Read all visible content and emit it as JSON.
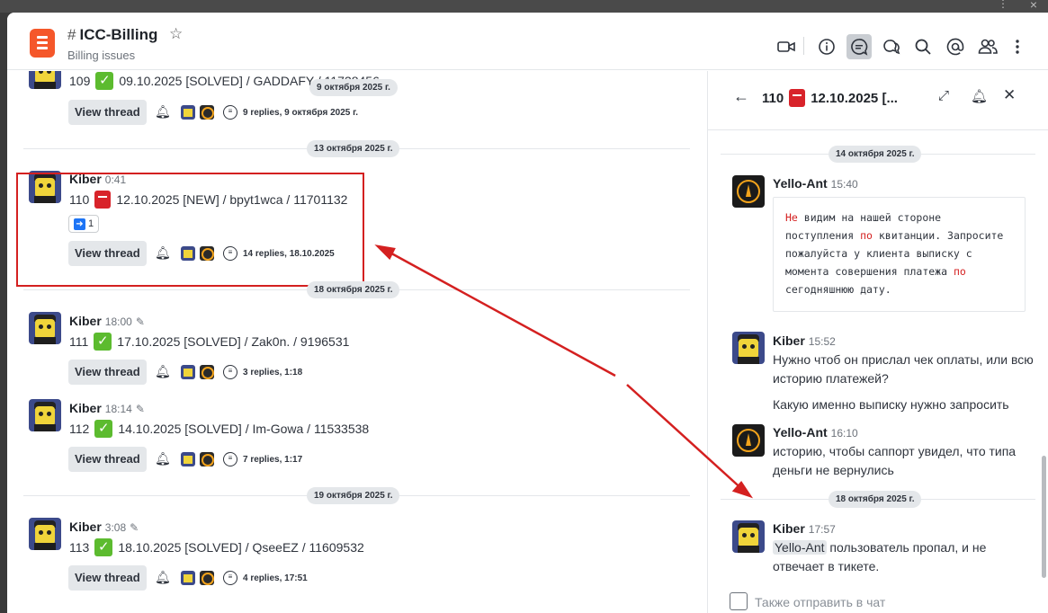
{
  "channel": {
    "name": "ICC-Billing",
    "topic": "Billing issues"
  },
  "header_icons": [
    "video-icon",
    "info-icon",
    "threads-icon",
    "discussions-icon",
    "search-icon",
    "mentions-icon",
    "members-icon",
    "kebab-icon"
  ],
  "feed": {
    "msg109": {
      "number": "109",
      "text": "09.10.2025 [SOLVED] / GADDAFY / 11738456",
      "replies": "9 replies, 9 октября 2025 г."
    },
    "pill_9oct": "9 октября 2025 г.",
    "day_13oct": "13 октября 2025 г.",
    "msg110": {
      "author": "Kiber",
      "time": "0:41",
      "number": "110",
      "text": "12.10.2025 [NEW] / bpyt1wca / 11701132",
      "reaction_count": "1",
      "replies": "14 replies, 18.10.2025"
    },
    "day_18oct": "18 октября 2025 г.",
    "msg111": {
      "author": "Kiber",
      "time": "18:00",
      "number": "111",
      "text": "17.10.2025 [SOLVED] / Zak0n. / 9196531",
      "replies": "3 replies, 1:18"
    },
    "msg112": {
      "author": "Kiber",
      "time": "18:14",
      "number": "112",
      "text": "14.10.2025 [SOLVED] / Im-Gowa / 11533538",
      "replies": "7 replies, 1:17"
    },
    "day_19oct": "19 октября 2025 г.",
    "msg113": {
      "author": "Kiber",
      "time": "3:08",
      "number": "113",
      "text": "18.10.2025 [SOLVED] / QseeEZ / 11609532",
      "replies": "4 replies, 17:51"
    },
    "view_thread": "View thread"
  },
  "thread": {
    "title_number": "110",
    "title_text": "12.10.2025 [...",
    "day1": "14 октября 2025 г.",
    "m1": {
      "author": "Yello-Ant",
      "time": "15:40",
      "l1a": "Не",
      "l1b": " видим на нашей стороне",
      "l2a": "поступления ",
      "l2b": "по",
      "l2c": " квитанции. Запросите",
      "l3": "пожалуйста у клиента выписку с",
      "l4a": "момента совершения платежа ",
      "l4b": "по",
      "l5": "сегодняшнюю дату."
    },
    "m2": {
      "author": "Kiber",
      "time": "15:52",
      "text": "Нужно чтоб он прислал чек оплаты, или всю историю платежей?",
      "text2": "Какую именно выписку нужно запросить"
    },
    "m3": {
      "author": "Yello-Ant",
      "time": "16:10",
      "text": "историю, чтобы саппорт увидел, что типа деньги не вернулись"
    },
    "day2": "18 октября 2025 г.",
    "m4": {
      "author": "Kiber",
      "time": "17:57",
      "mention": "Yello-Ant",
      "text": " пользователь пропал, и не отвечает в тикете."
    },
    "also_send": "Также отправить в чат"
  },
  "colors": {
    "accent": "#1d74f5",
    "annotation_red": "#d42020",
    "check_green": "#5cbb2f"
  }
}
